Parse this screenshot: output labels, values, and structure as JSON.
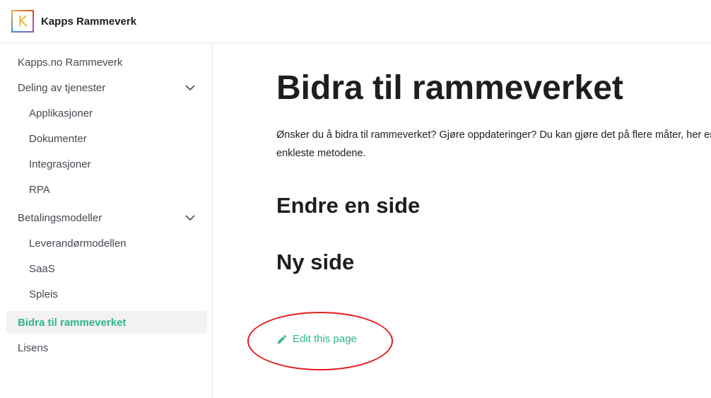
{
  "navbar": {
    "logo_letter": "K",
    "title": "Kapps Rammeverk"
  },
  "sidebar": {
    "items": [
      {
        "label": "Kapps.no Rammeverk"
      },
      {
        "label": "Deling av tjenester",
        "expanded": true
      },
      {
        "label": "Applikasjoner"
      },
      {
        "label": "Dokumenter"
      },
      {
        "label": "Integrasjoner"
      },
      {
        "label": "RPA"
      },
      {
        "label": "Betalingsmodeller",
        "expanded": true
      },
      {
        "label": "Leverandørmodellen"
      },
      {
        "label": "SaaS"
      },
      {
        "label": "Spleis"
      },
      {
        "label": "Bidra til rammeverket",
        "active": true
      },
      {
        "label": "Lisens"
      }
    ]
  },
  "main": {
    "title": "Bidra til rammeverket",
    "intro": "Ønsker du å bidra til rammeverket? Gjøre oppdateringer? Du kan gjøre det på flere måter, her er de enkleste metodene.",
    "sections": [
      "Endre en side",
      "Ny side"
    ],
    "edit_link": "Edit this page"
  },
  "colors": {
    "accent": "#2fb58d",
    "annotation": "#e01e1e",
    "logo_letter": "#e9b429"
  }
}
